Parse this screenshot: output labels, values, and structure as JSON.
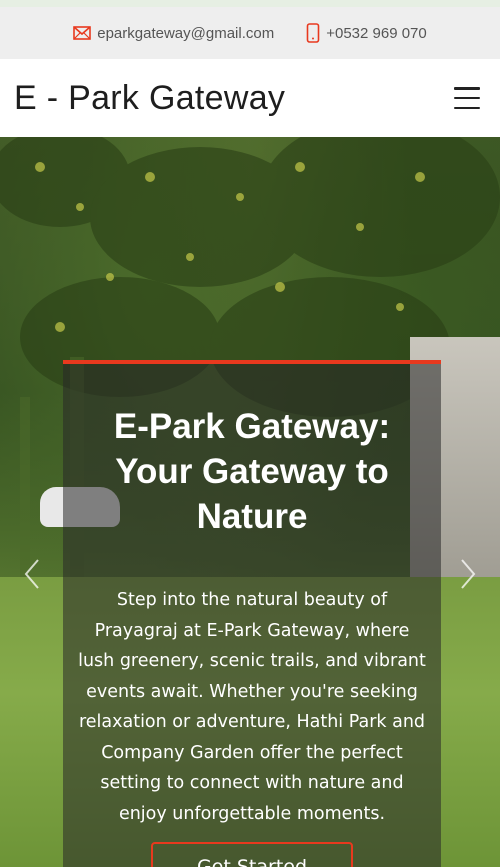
{
  "topbar": {
    "email": "eparkgateway@gmail.com",
    "phone": "+0532 969 070",
    "email_icon": "envelope-icon",
    "phone_icon": "mobile-phone-icon"
  },
  "navbar": {
    "brand": "E - Park Gateway",
    "menu_icon": "hamburger-menu-icon"
  },
  "hero": {
    "title": "E-Park Gateway: Your Gateway to Nature",
    "description": "Step into the natural beauty of Prayagraj at E-Park Gateway, where lush greenery, scenic trails, and vibrant events await. Whether you're seeking relaxation or adventure, Hathi Park and Company Garden offer the perfect setting to connect with nature and enjoy unforgettable moments.",
    "cta_label": "Get Started",
    "prev_icon": "chevron-left-icon",
    "next_icon": "chevron-right-icon"
  },
  "colors": {
    "accent": "#e8391e",
    "topbar_bg": "#eeeeee",
    "caption_bg": "rgba(40,40,40,0.55)"
  }
}
